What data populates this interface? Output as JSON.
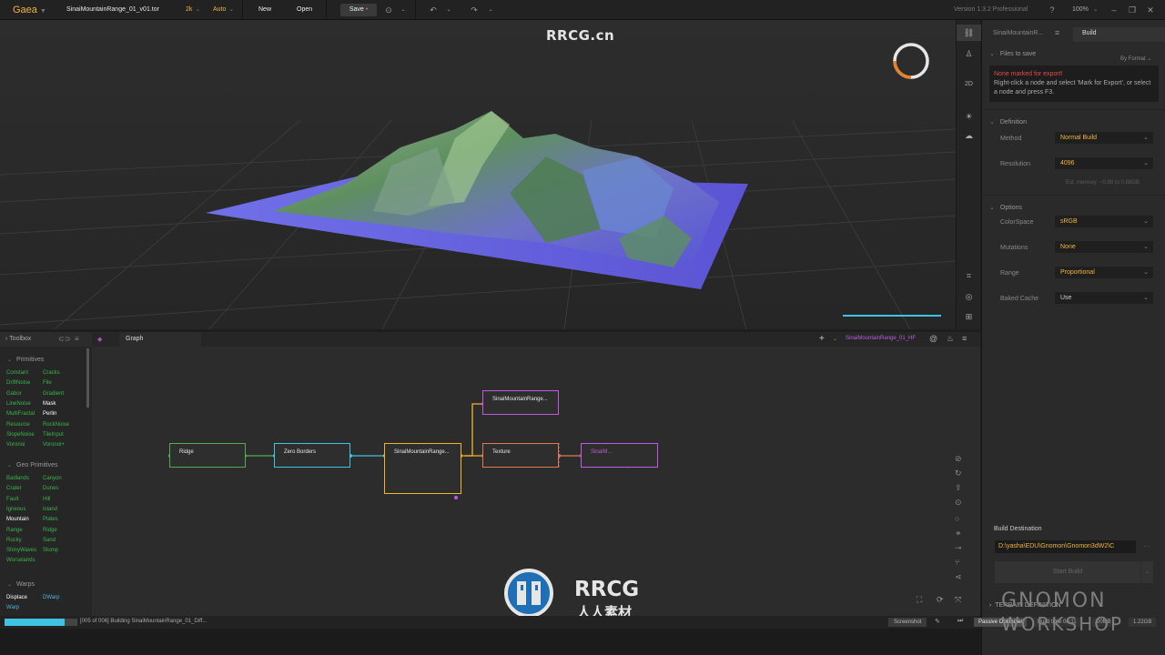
{
  "topbar": {
    "app_name": "Gaea",
    "file_name": "SinaiMountainRange_01_v01.tor",
    "resolution": "2k",
    "mode": "Auto",
    "new_label": "New",
    "open_label": "Open",
    "save_label": "Save",
    "save_dot": "•",
    "version": "Version 1.3.2 Professional",
    "zoom": "100%"
  },
  "site_watermark": "RRCG.cn",
  "right_tools": {
    "twod_label": "2D"
  },
  "build_panel": {
    "tab_left": "SinaiMountainR...",
    "tab_right": "Build",
    "files_to_save": "Files to save",
    "by_format": "By Format",
    "warning_red": "None marked for export!",
    "warning_text": "Right-click a node and select 'Mark for Export', or select a node and press F3.",
    "definition_label": "Definition",
    "method_label": "Method",
    "method_value": "Normal Build",
    "resolution_label": "Resolution",
    "resolution_value": "4096",
    "est_memory": "Est. memory: ~0.88 to 0.88GB",
    "options_label": "Options",
    "colorspace_label": "ColorSpace",
    "colorspace_value": "sRGB",
    "mutations_label": "Mutations",
    "mutations_value": "None",
    "range_label": "Range",
    "range_value": "Proportional",
    "baked_cache_label": "Baked Cache",
    "baked_cache_value": "Use",
    "build_destination_label": "Build Destination",
    "build_destination_value": "D:\\yasha\\EDU\\Gnomon\\Gnomon3dW2\\C",
    "start_build": "Start Build",
    "terrain_definition": "TERRAIN DEFINITION"
  },
  "toolbox": {
    "title": "Toolbox",
    "groups": [
      {
        "name": "Primitives",
        "items": [
          "Constant",
          "Cracks",
          "DriftNoise",
          "File",
          "Gabor",
          "Gradient",
          "LineNoise",
          "Mask",
          "MultiFractal",
          "Perlin",
          "Resource",
          "RockNoise",
          "SlopeNoise",
          "TileInput",
          "Voronoi",
          "Voronoi+"
        ]
      },
      {
        "name": "Geo Primitives",
        "items": [
          "Badlands",
          "Canyon",
          "Crater",
          "Dunes",
          "Fault",
          "Hill",
          "Igneous",
          "Island",
          "Mountain",
          "Plates",
          "Range",
          "Ridge",
          "Rocky",
          "Sand",
          "ShinyWaves",
          "Slump",
          "Worselands"
        ]
      },
      {
        "name": "Warps",
        "items": [
          "Displace",
          "DWarp",
          "Warp"
        ]
      }
    ]
  },
  "graph": {
    "tab": "Graph",
    "breadcrumb": "SinaiMountainRange_01_HF",
    "nodes": [
      {
        "label": "Ridge",
        "color": "#4caf50"
      },
      {
        "label": "Zero Borders",
        "color": "#3ec3e3"
      },
      {
        "label": "SinaiMountainRange...",
        "color": "#f0b429"
      },
      {
        "label": "SinaiMountainRange...",
        "color": "#c05be0"
      },
      {
        "label": "Texture",
        "color": "#e07a4b"
      },
      {
        "label": "SinaiM...",
        "color": "#c05be0"
      }
    ],
    "watermark_brand": "RRCG",
    "watermark_cn": "人人素材"
  },
  "status": {
    "build_progress": 0.83,
    "message": "[005 of 006] Building SinaiMountainRange_01_Diff...",
    "screenshot": "Screenshot",
    "passive_optimizer": "Passive Optimizer",
    "build_time": "Build time 00:11",
    "memory_small": "00MB",
    "memory_total": "1.22GB"
  },
  "gnomon_mark": [
    "GNOMON",
    "WORKSHOP"
  ]
}
